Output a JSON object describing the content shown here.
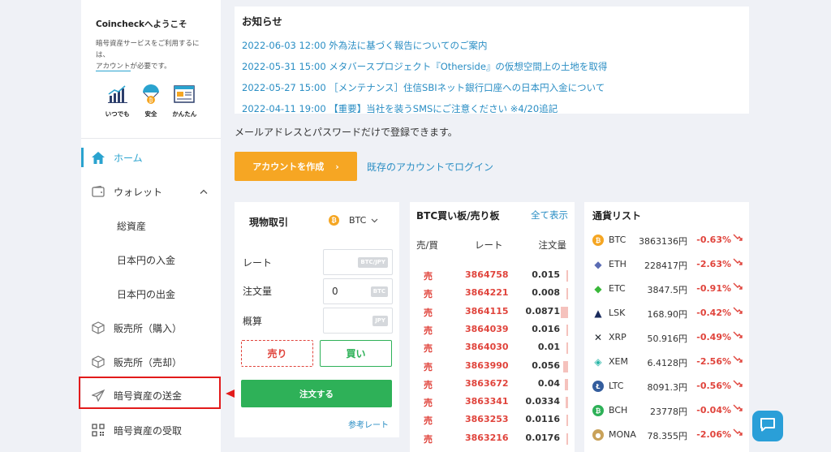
{
  "sidebar": {
    "welcome_title": "Coincheckへようこそ",
    "welcome_text_1": "暗号資産サービスをご利用するには、",
    "welcome_account": "アカウント",
    "welcome_text_2": "が必要です。",
    "features": [
      {
        "label": "いつでも",
        "icon": "chart-growth-icon"
      },
      {
        "label": "安全",
        "icon": "parachute-bitcoin-icon"
      },
      {
        "label": "かんたん",
        "icon": "browser-window-icon"
      }
    ],
    "nav": {
      "home": "ホーム",
      "wallet": "ウォレット",
      "total_assets": "総資産",
      "jpy_deposit": "日本円の入金",
      "jpy_withdraw": "日本円の出金",
      "shop_buy": "販売所（購入）",
      "shop_sell": "販売所（売却）",
      "crypto_send": "暗号資産の送金",
      "crypto_receive": "暗号資産の受取"
    }
  },
  "news": {
    "title": "お知らせ",
    "items": [
      "2022-06-03 12:00 外為法に基づく報告についてのご案内",
      "2022-05-31 15:00 メタバースプロジェクト『Otherside』の仮想空間上の土地を取得",
      "2022-05-27 15:00 ［メンテナンス］住信SBIネット銀行口座への日本円入金について",
      "2022-04-11 19:00 【重要】当社を装うSMSにご注意ください ※4/20追記"
    ]
  },
  "signup": {
    "text": "メールアドレスとパスワードだけで登録できます。",
    "create_button": "アカウントを作成",
    "create_arrow": "›",
    "login_link": "既存のアカウントでログイン"
  },
  "trade": {
    "title": "現物取引",
    "coin": "BTC",
    "coin_symbol": "₿",
    "rate_label": "レート",
    "rate_unit": "BTC/JPY",
    "amount_label": "注文量",
    "amount_value": "0",
    "amount_unit": "BTC",
    "estimate_label": "概算",
    "estimate_unit": "JPY",
    "sell_button": "売り",
    "buy_button": "買い",
    "order_button": "注文する",
    "ref_rate": "参考レート"
  },
  "book": {
    "title": "BTC買い板/売り板",
    "show_all": "全て表示",
    "col_side": "売/買",
    "col_rate": "レート",
    "col_amount": "注文量",
    "rows": [
      {
        "side": "売",
        "price": "3864758",
        "amount": "0.015",
        "bar": 0.1
      },
      {
        "side": "売",
        "price": "3864221",
        "amount": "0.008",
        "bar": 0.05
      },
      {
        "side": "売",
        "price": "3864115",
        "amount": "0.0871",
        "bar": 0.55
      },
      {
        "side": "売",
        "price": "3864039",
        "amount": "0.016",
        "bar": 0.1
      },
      {
        "side": "売",
        "price": "3864030",
        "amount": "0.01",
        "bar": 0.06
      },
      {
        "side": "売",
        "price": "3863990",
        "amount": "0.056",
        "bar": 0.35
      },
      {
        "side": "売",
        "price": "3863672",
        "amount": "0.04",
        "bar": 0.25
      },
      {
        "side": "売",
        "price": "3863341",
        "amount": "0.0334",
        "bar": 0.2
      },
      {
        "side": "売",
        "price": "3863253",
        "amount": "0.0116",
        "bar": 0.07
      },
      {
        "side": "売",
        "price": "3863216",
        "amount": "0.0176",
        "bar": 0.1
      }
    ]
  },
  "currencies": {
    "title": "通貨リスト",
    "items": [
      {
        "symbol": "BTC",
        "price": "3863136円",
        "change": "-0.63%",
        "icon": "btc-icon",
        "color": "#f5a623"
      },
      {
        "symbol": "ETH",
        "price": "228417円",
        "change": "-2.63%",
        "icon": "eth-icon",
        "color": "#5b6cb4"
      },
      {
        "symbol": "ETC",
        "price": "3847.5円",
        "change": "-0.91%",
        "icon": "etc-icon",
        "color": "#3ab83a"
      },
      {
        "symbol": "LSK",
        "price": "168.90円",
        "change": "-0.42%",
        "icon": "lsk-icon",
        "color": "#1a2b5c"
      },
      {
        "symbol": "XRP",
        "price": "50.916円",
        "change": "-0.49%",
        "icon": "xrp-icon",
        "color": "#23292f"
      },
      {
        "symbol": "XEM",
        "price": "6.4128円",
        "change": "-2.56%",
        "icon": "xem-icon",
        "color": "#29b6a8"
      },
      {
        "symbol": "LTC",
        "price": "8091.3円",
        "change": "-0.56%",
        "icon": "ltc-icon",
        "color": "#345d9d"
      },
      {
        "symbol": "BCH",
        "price": "23778円",
        "change": "-0.04%",
        "icon": "bch-icon",
        "color": "#2eb158"
      },
      {
        "symbol": "MONA",
        "price": "78.355円",
        "change": "-2.06%",
        "icon": "mona-icon",
        "color": "#c9a25a"
      }
    ]
  },
  "colors": {
    "accent": "#2aa3cf",
    "sell": "#e0443c",
    "buy": "#2eb158",
    "orange": "#f6a623",
    "highlight": "#e21b1b"
  }
}
